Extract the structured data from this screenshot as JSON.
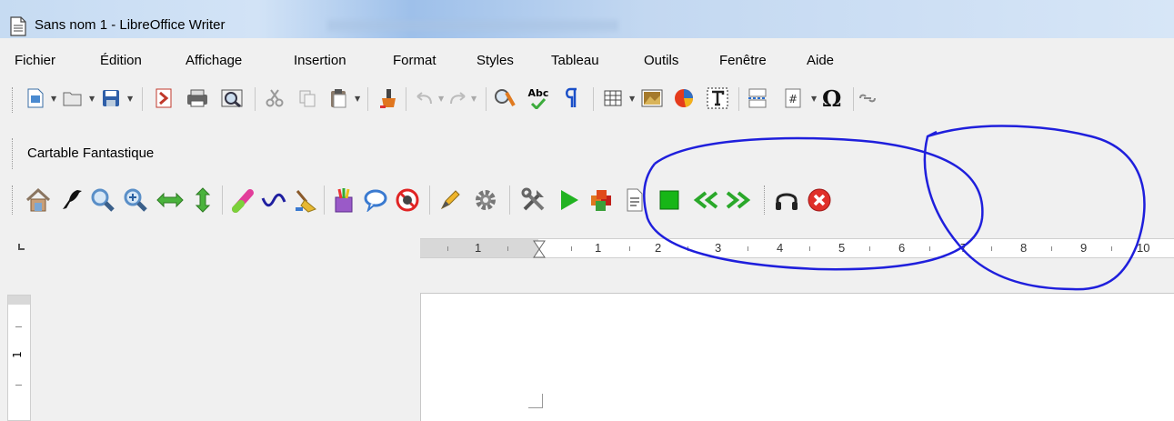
{
  "window": {
    "title": "Sans nom 1 - LibreOffice Writer"
  },
  "menu": [
    {
      "label": "Fichier"
    },
    {
      "label": "Édition"
    },
    {
      "label": "Affichage"
    },
    {
      "label": "Insertion"
    },
    {
      "label": "Format"
    },
    {
      "label": "Styles"
    },
    {
      "label": "Tableau"
    },
    {
      "label": "Outils"
    },
    {
      "label": "Fenêtre"
    },
    {
      "label": "Aide"
    }
  ],
  "toolbar_standard": {
    "spellcheck_label": "Abc"
  },
  "toolbar_cartable": {
    "title": "Cartable Fantastique"
  },
  "ruler": {
    "numbers": [
      "1",
      "1",
      "2",
      "3",
      "4",
      "5",
      "6",
      "7",
      "8",
      "9",
      "10"
    ]
  },
  "vertical_ruler": {
    "number": "1"
  },
  "colors": {
    "annotation": "#1f1fdc",
    "play": "#21b321",
    "stop": "#17b617",
    "close": "#e0302a"
  },
  "icons": {
    "standard": [
      "new-doc-icon",
      "open-folder-icon",
      "save-icon",
      "export-pdf-icon",
      "print-icon",
      "print-preview-icon",
      "cut-icon",
      "copy-icon",
      "paste-icon",
      "clone-formatting-icon",
      "undo-icon",
      "redo-icon",
      "find-replace-icon",
      "spellcheck-icon",
      "formatting-marks-icon",
      "insert-table-icon",
      "insert-image-icon",
      "insert-chart-icon",
      "insert-textbox-icon",
      "page-break-icon",
      "insert-field-icon",
      "special-character-icon"
    ],
    "cartable": [
      "home-icon",
      "bird-icon",
      "zoom-icon",
      "zoom-in-icon",
      "horizontal-arrows-icon",
      "vertical-arrows-icon",
      "highlighter-icon",
      "wave-icon",
      "broom-icon",
      "paint-pots-icon",
      "speech-bubble-icon",
      "no-entry-icon",
      "pencil-icon",
      "settings-gear-icon",
      "tools-icon",
      "play-icon",
      "cubes-icon",
      "document-icon",
      "stop-icon",
      "rewind-icon",
      "fast-forward-icon",
      "headphones-icon",
      "close-circle-icon"
    ]
  }
}
